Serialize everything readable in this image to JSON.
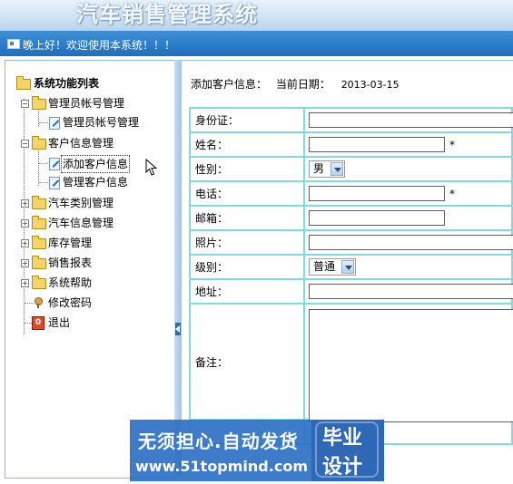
{
  "header": {
    "system_title": "汽车销售管理系统"
  },
  "welcome_bar": {
    "text": "晚上好！欢迎使用本系统！！！"
  },
  "sidebar": {
    "root_label": "系统功能列表",
    "groups": [
      {
        "label": "管理员帐号管理",
        "expanded": true,
        "children": [
          {
            "label": "管理员帐号管理"
          }
        ]
      },
      {
        "label": "客户信息管理",
        "expanded": true,
        "children": [
          {
            "label": "添加客户信息",
            "selected": true
          },
          {
            "label": "管理客户信息"
          }
        ]
      },
      {
        "label": "汽车类别管理",
        "expanded": false,
        "children": []
      },
      {
        "label": "汽车信息管理",
        "expanded": false,
        "children": []
      },
      {
        "label": "库存管理",
        "expanded": false,
        "children": []
      },
      {
        "label": "销售报表",
        "expanded": false,
        "children": []
      },
      {
        "label": "系统帮助",
        "expanded": false,
        "children": []
      }
    ],
    "leaf_items": [
      {
        "label": "修改密码",
        "icon": "key-icon"
      },
      {
        "label": "退出",
        "icon": "exit-icon"
      }
    ],
    "expand_symbol_open": "−",
    "expand_symbol_closed": "+"
  },
  "content": {
    "section_label": "添加客户信息：",
    "date_label": "当前日期：",
    "date_value": "2013-03-15",
    "form": {
      "id_card": {
        "label": "身份证：",
        "value": ""
      },
      "name": {
        "label": "姓名：",
        "value": "",
        "required_mark": "*"
      },
      "gender": {
        "label": "性别：",
        "selected": "男"
      },
      "phone": {
        "label": "电话：",
        "value": "",
        "required_mark": "*"
      },
      "email": {
        "label": "邮箱：",
        "value": ""
      },
      "photo": {
        "label": "照片：",
        "value": ""
      },
      "level": {
        "label": "级别：",
        "selected": "普通"
      },
      "address": {
        "label": "地址：",
        "value": ""
      },
      "remark": {
        "label": "备注：",
        "value": ""
      }
    }
  },
  "watermark": {
    "line1": "无须担心.自动发货",
    "line2": "www.51topmind.com",
    "badge_line1": "毕业",
    "badge_line2": "设计"
  },
  "colors": {
    "welcome_bar": "#1d6fbf",
    "table_border": "#84d8e0",
    "panel_border": "#8fb7dc",
    "watermark_bg": "#2e70c4"
  }
}
